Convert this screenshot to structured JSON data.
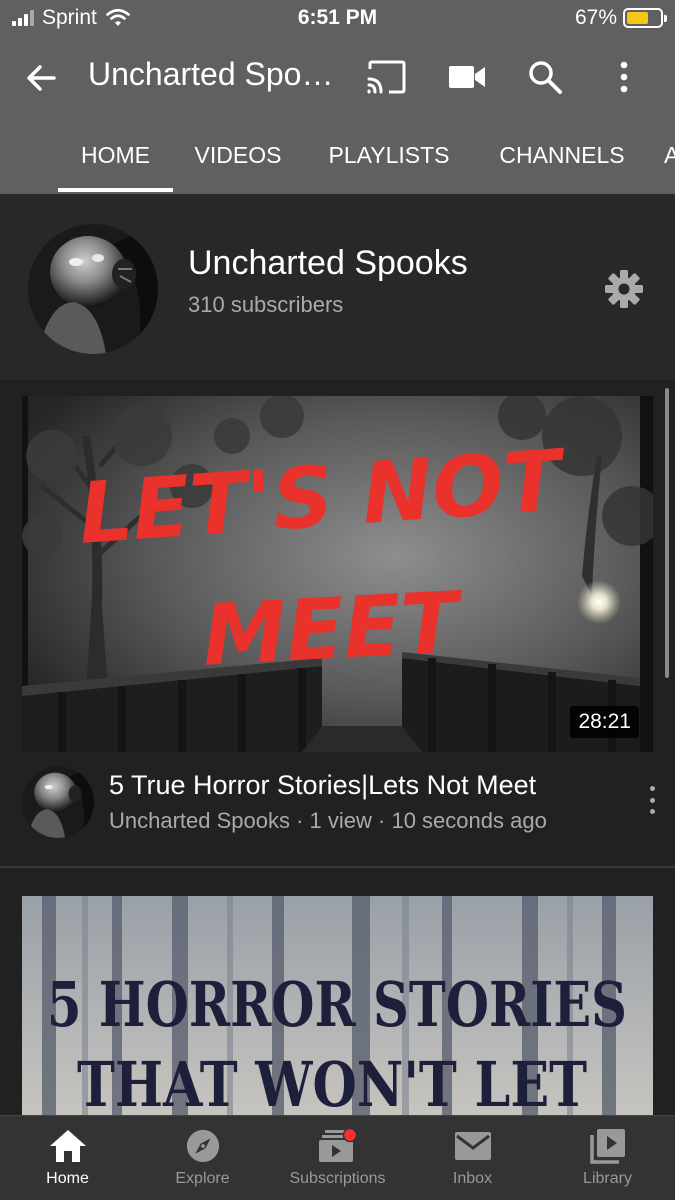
{
  "status_bar": {
    "carrier": "Sprint",
    "time": "6:51 PM",
    "battery_percent": "67%",
    "battery_level": 0.67
  },
  "app_bar": {
    "title": "Uncharted Spo…",
    "icons": [
      "back-arrow-icon",
      "cast-icon",
      "camera-icon",
      "search-icon",
      "more-vert-icon"
    ]
  },
  "tabs": [
    {
      "label": "HOME",
      "active": true
    },
    {
      "label": "VIDEOS",
      "active": false
    },
    {
      "label": "PLAYLISTS",
      "active": false
    },
    {
      "label": "CHANNELS",
      "active": false
    },
    {
      "label": "A",
      "active": false
    }
  ],
  "channel": {
    "name": "Uncharted Spooks",
    "subscribers": "310 subscribers"
  },
  "videos": [
    {
      "thumbnail_text_1": "LET'S NOT",
      "thumbnail_text_2": "MEET",
      "duration": "28:21",
      "title": "5 True Horror Stories|Lets Not Meet",
      "subtitle": "Uncharted Spooks · 1 view · 10 seconds ago"
    },
    {
      "thumbnail_text_1": "5 HORROR STORIES",
      "thumbnail_text_2": "THAT WON'T LET"
    }
  ],
  "bottom_nav": [
    {
      "label": "Home",
      "icon": "home-icon",
      "active": true
    },
    {
      "label": "Explore",
      "icon": "compass-icon",
      "active": false
    },
    {
      "label": "Subscriptions",
      "icon": "subscriptions-icon",
      "active": false
    },
    {
      "label": "Inbox",
      "icon": "mail-icon",
      "active": false
    },
    {
      "label": "Library",
      "icon": "library-icon",
      "active": false
    }
  ],
  "colors": {
    "header_bg": "#606060",
    "content_bg": "#282828",
    "feed_bg": "#212121",
    "nav_bg": "#333333",
    "thumbnail_title_red": "#e8322b",
    "notification_dot": "#ff2d2d"
  }
}
